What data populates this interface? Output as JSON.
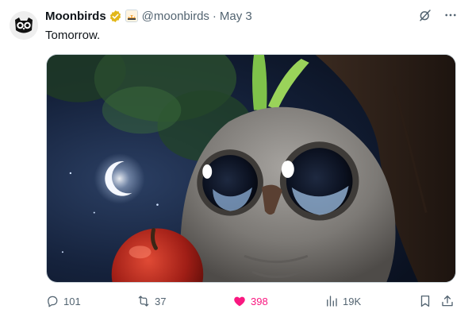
{
  "tweet": {
    "display_name": "Moonbirds",
    "handle": "@moonbirds",
    "separator": "·",
    "date": "May 3",
    "text": "Tomorrow."
  },
  "icons": {
    "avatar": "moonbirds-owl-logo",
    "verified": "gold-verified-badge",
    "affiliate": "affiliate-badge",
    "grok": "grok-icon",
    "more": "more-dots-icon",
    "reply": "reply-icon",
    "retweet": "retweet-icon",
    "like": "heart-icon",
    "views": "views-icon",
    "bookmark": "bookmark-icon",
    "share": "share-icon"
  },
  "actions": {
    "replies": "101",
    "retweets": "37",
    "likes": "398",
    "views": "19K"
  },
  "colors": {
    "text": "#0f1419",
    "secondary": "#536471",
    "like_active": "#f91880",
    "verified_gold": "#e2b719"
  }
}
